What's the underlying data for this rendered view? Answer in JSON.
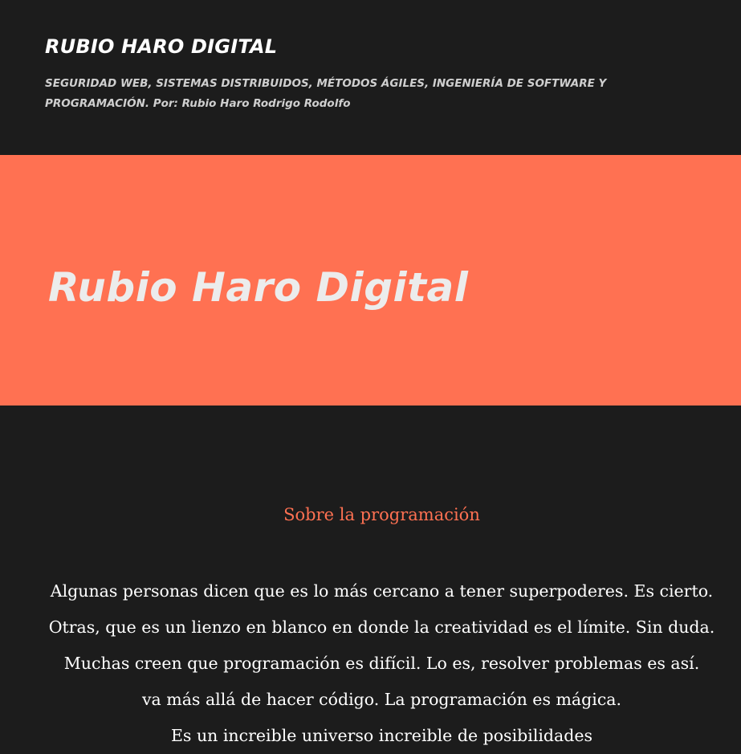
{
  "header": {
    "site_title": "RUBIO HARO DIGITAL",
    "tagline": "SEGURIDAD WEB, SISTEMAS DISTRIBUIDOS, MÉTODOS ÁGILES, INGENIERÍA DE SOFTWARE Y PROGRAMACIÓN. Por: Rubio Haro Rodrigo Rodolfo"
  },
  "hero": {
    "title": "Rubio Haro Digital"
  },
  "content": {
    "section_heading": "Sobre la programación",
    "lines": [
      "Algunas personas dicen que es lo más cercano a tener superpoderes. Es cierto.",
      "Otras, que es un lienzo en blanco en donde la creatividad es el límite. Sin duda.",
      "Muchas creen que programación es difícil. Lo es, resolver problemas es así.",
      "va más allá de hacer código. La programación es mágica.",
      "Es un increible universo increible de posibilidades"
    ]
  },
  "colors": {
    "background": "#1c1c1c",
    "accent": "#ff7152",
    "text": "#ffffff",
    "tagline": "#cfcfcf",
    "hero_text": "#ececec"
  }
}
